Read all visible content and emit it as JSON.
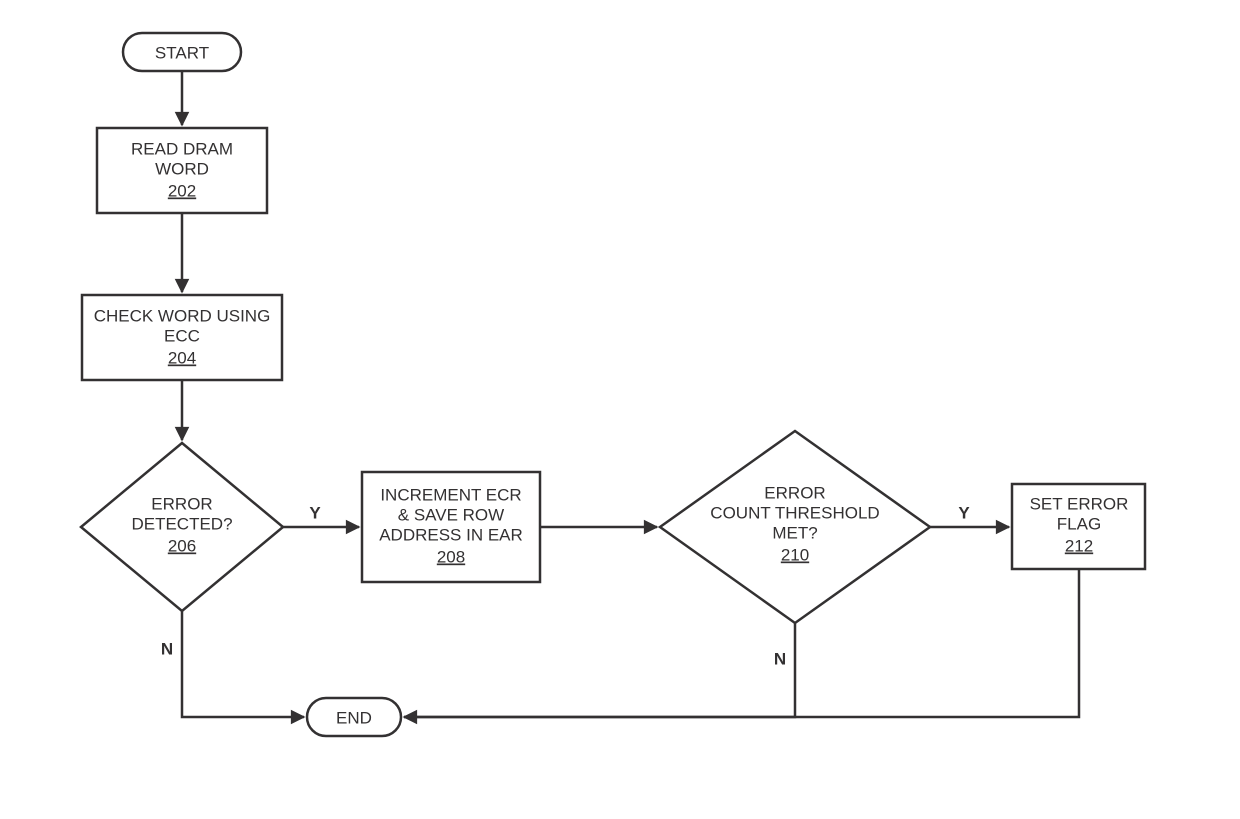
{
  "nodes": {
    "start": {
      "label": "START"
    },
    "read": {
      "line1": "READ DRAM",
      "line2": "WORD",
      "ref": "202"
    },
    "check": {
      "line1": "CHECK WORD USING",
      "line2": "ECC",
      "ref": "204"
    },
    "detect": {
      "line1": "ERROR",
      "line2": "DETECTED?",
      "ref": "206"
    },
    "incr": {
      "line1": "INCREMENT ECR",
      "line2": "& SAVE ROW",
      "line3": "ADDRESS IN EAR",
      "ref": "208"
    },
    "thresh": {
      "line1": "ERROR",
      "line2": "COUNT THRESHOLD",
      "line3": "MET?",
      "ref": "210"
    },
    "setflag": {
      "line1": "SET ERROR",
      "line2": "FLAG",
      "ref": "212"
    },
    "end": {
      "label": "END"
    }
  },
  "edges": {
    "detect_yes": "Y",
    "detect_no": "N",
    "thresh_yes": "Y",
    "thresh_no": "N"
  }
}
